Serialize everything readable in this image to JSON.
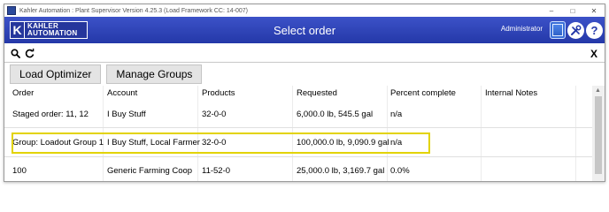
{
  "window": {
    "title": "Kahler Automation : Plant Supervisor Version 4.25.3 (Load Framework CC: 14-007)",
    "controls": {
      "minimize": "–",
      "maximize": "□",
      "close": "✕"
    }
  },
  "header": {
    "logo": {
      "mark": "K",
      "line1": "KAHLER",
      "line2": "AUTOMATION"
    },
    "title": "Select order",
    "user": "Administrator",
    "help": "?"
  },
  "search": {
    "value": "",
    "placeholder": "",
    "clear": "X"
  },
  "toolbar": {
    "load_optimizer": "Load Optimizer",
    "manage_groups": "Manage Groups"
  },
  "table": {
    "columns": [
      "Order",
      "Account",
      "Products",
      "Requested",
      "Percent complete",
      "Internal Notes"
    ],
    "rows": [
      {
        "order": "Staged order: 11, 12",
        "account": "I Buy Stuff",
        "products": "32-0-0",
        "requested": "6,000.0 lb, 545.5 gal",
        "percent": "n/a",
        "notes": ""
      },
      {
        "order": "Group: Loadout Group 1",
        "account": "I Buy Stuff, Local Farmer",
        "products": "32-0-0",
        "requested": "100,000.0 lb, 9,090.9 gal",
        "percent": "n/a",
        "notes": ""
      },
      {
        "order": "100",
        "account": "Generic Farming Coop",
        "products": "11-52-0",
        "requested": "25,000.0 lb, 3,169.7 gal",
        "percent": "0.0%",
        "notes": ""
      }
    ]
  },
  "colors": {
    "header_blue": "#2f44b8",
    "highlight": "#e2d300"
  },
  "icons": {
    "search": "search-icon",
    "refresh": "refresh-icon",
    "clear": "close-icon",
    "keypad": "keypad-icon",
    "tools": "tools-icon",
    "help": "help-icon"
  }
}
